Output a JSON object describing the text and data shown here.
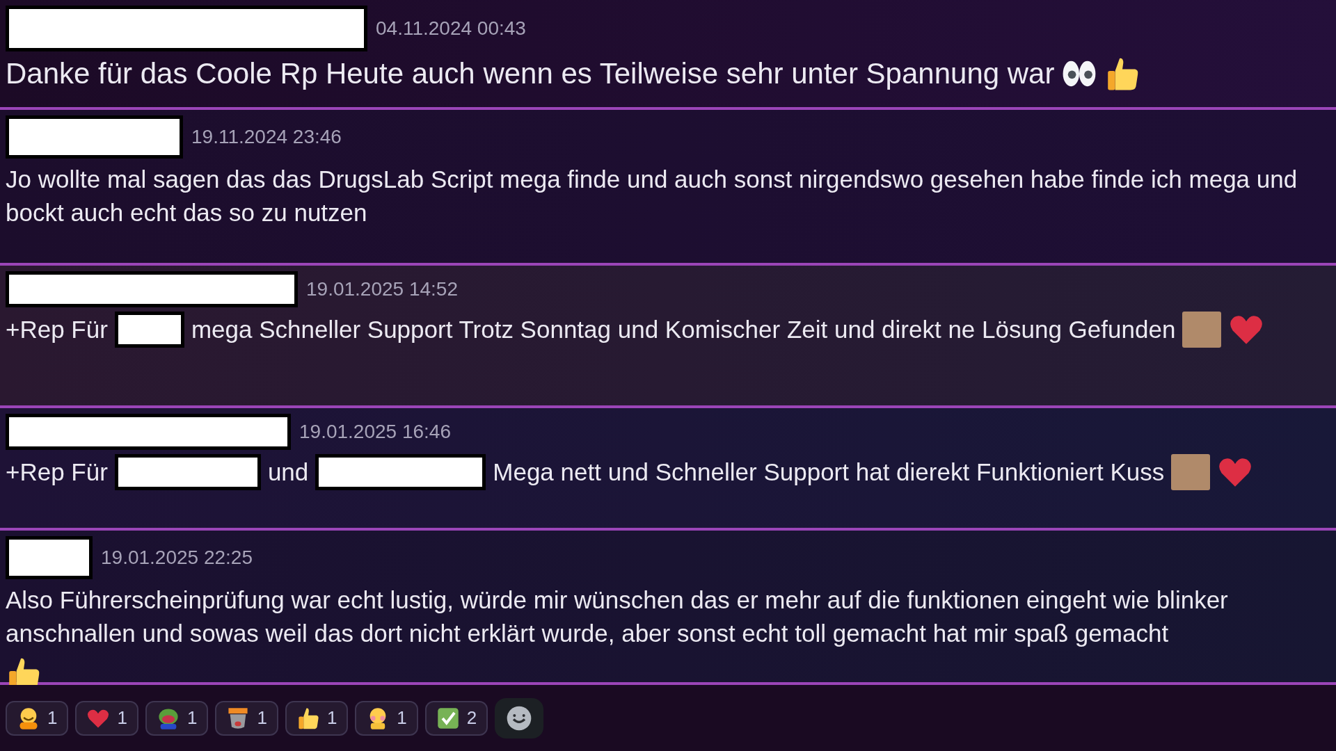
{
  "messages": [
    {
      "timestamp": "04.11.2024 00:43",
      "parts": [
        {
          "kind": "text",
          "text": "Danke für das Coole Rp Heute auch wenn es Teilweise sehr unter Spannung war"
        },
        {
          "kind": "eyes"
        },
        {
          "kind": "thumb"
        }
      ]
    },
    {
      "timestamp": "19.11.2024 23:46",
      "parts": [
        {
          "kind": "text",
          "text": "Jo wollte mal sagen das das DrugsLab Script mega finde und auch sonst nirgendswo gesehen habe finde ich mega und bockt auch echt das so zu nutzen"
        }
      ]
    },
    {
      "timestamp": "19.01.2025 14:52",
      "parts": [
        {
          "kind": "text",
          "text": "+Rep Für"
        },
        {
          "kind": "redacted"
        },
        {
          "kind": "text",
          "text": "mega Schneller Support Trotz Sonntag und Komischer Zeit und direkt ne Lösung Gefunden"
        },
        {
          "kind": "photo"
        },
        {
          "kind": "heart"
        }
      ]
    },
    {
      "timestamp": "19.01.2025 16:46",
      "parts": [
        {
          "kind": "text",
          "text": "+Rep Für"
        },
        {
          "kind": "redacted"
        },
        {
          "kind": "text",
          "text": "und"
        },
        {
          "kind": "redacted"
        },
        {
          "kind": "text",
          "text": "Mega nett und Schneller Support hat dierekt Funktioniert Kuss"
        },
        {
          "kind": "photo"
        },
        {
          "kind": "heart"
        }
      ]
    },
    {
      "timestamp": "19.01.2025 22:25",
      "parts": [
        {
          "kind": "text",
          "text": "Also Führerscheinprüfung war echt lustig, würde mir wünschen das er mehr auf die funktionen eingeht wie blinker anschnallen und sowas weil das dort nicht erklärt wurde, aber sonst echt toll gemacht hat mir spaß gemacht"
        },
        {
          "kind": "thumb"
        }
      ]
    }
  ],
  "reactions": [
    {
      "kind": "hug",
      "count": "1"
    },
    {
      "kind": "heart",
      "count": "1"
    },
    {
      "kind": "frog",
      "count": "1"
    },
    {
      "kind": "hype",
      "count": "1"
    },
    {
      "kind": "thumb",
      "count": "1"
    },
    {
      "kind": "blush",
      "count": "1"
    },
    {
      "kind": "check",
      "count": "2"
    }
  ]
}
